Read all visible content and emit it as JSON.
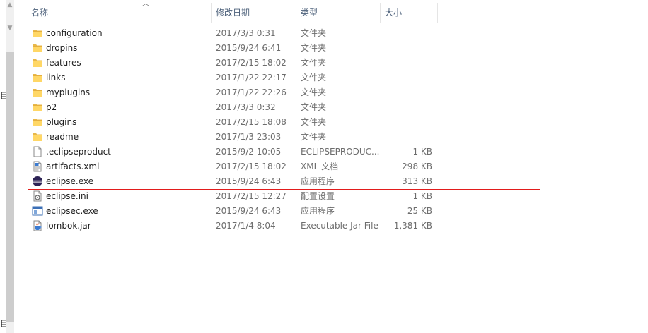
{
  "header": {
    "name": "名称",
    "date": "修改日期",
    "type": "类型",
    "size": "大小"
  },
  "files": [
    {
      "name": "configuration",
      "date": "2017/3/3 0:31",
      "type": "文件夹",
      "size": "",
      "icon": "folder-icon"
    },
    {
      "name": "dropins",
      "date": "2015/9/24 6:41",
      "type": "文件夹",
      "size": "",
      "icon": "folder-icon"
    },
    {
      "name": "features",
      "date": "2017/2/15 18:02",
      "type": "文件夹",
      "size": "",
      "icon": "folder-icon"
    },
    {
      "name": "links",
      "date": "2017/1/22 22:17",
      "type": "文件夹",
      "size": "",
      "icon": "folder-icon"
    },
    {
      "name": "myplugins",
      "date": "2017/1/22 22:26",
      "type": "文件夹",
      "size": "",
      "icon": "folder-icon"
    },
    {
      "name": "p2",
      "date": "2017/3/3 0:32",
      "type": "文件夹",
      "size": "",
      "icon": "folder-icon"
    },
    {
      "name": "plugins",
      "date": "2017/2/15 18:08",
      "type": "文件夹",
      "size": "",
      "icon": "folder-icon"
    },
    {
      "name": "readme",
      "date": "2017/1/3 23:03",
      "type": "文件夹",
      "size": "",
      "icon": "folder-icon"
    },
    {
      "name": ".eclipseproduct",
      "date": "2015/9/2 10:05",
      "type": "ECLIPSEPRODUC...",
      "size": "1 KB",
      "icon": "blank-file-icon"
    },
    {
      "name": "artifacts.xml",
      "date": "2017/2/15 18:02",
      "type": "XML 文档",
      "size": "298 KB",
      "icon": "xml-file-icon"
    },
    {
      "name": "eclipse.exe",
      "date": "2015/9/24 6:43",
      "type": "应用程序",
      "size": "313 KB",
      "icon": "eclipse-icon",
      "selected": true
    },
    {
      "name": "eclipse.ini",
      "date": "2017/2/15 12:27",
      "type": "配置设置",
      "size": "1 KB",
      "icon": "settings-file-icon"
    },
    {
      "name": "eclipsec.exe",
      "date": "2015/9/24 6:43",
      "type": "应用程序",
      "size": "25 KB",
      "icon": "application-icon"
    },
    {
      "name": "lombok.jar",
      "date": "2017/1/4 8:04",
      "type": "Executable Jar File",
      "size": "1,381 KB",
      "icon": "jar-file-icon"
    }
  ]
}
